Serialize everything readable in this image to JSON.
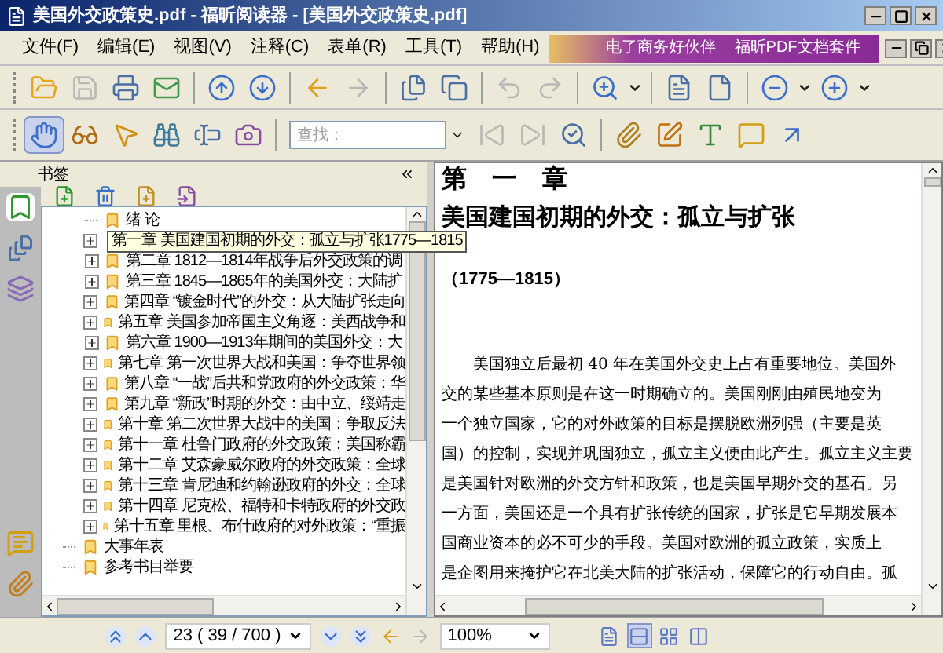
{
  "window": {
    "title": "美国外交政策史.pdf - 福昕阅读器 - [美国外交政策史.pdf]"
  },
  "menu": [
    "文件(F)",
    "编辑(E)",
    "视图(V)",
    "注释(C)",
    "表单(R)",
    "工具(T)",
    "帮助(H)"
  ],
  "banner": {
    "slogan": "电了商务好伙伴",
    "product": "福昕PDF文档套件"
  },
  "toolbar_1": [
    {
      "kind": "open",
      "disabled": false
    },
    {
      "kind": "save",
      "disabled": true
    },
    {
      "kind": "print",
      "disabled": false
    },
    {
      "kind": "mail",
      "disabled": false
    },
    {
      "kind": "sep"
    },
    {
      "kind": "up",
      "disabled": false
    },
    {
      "kind": "down",
      "disabled": false
    },
    {
      "kind": "sep"
    },
    {
      "kind": "back",
      "disabled": false
    },
    {
      "kind": "forward",
      "disabled": true
    },
    {
      "kind": "sep"
    },
    {
      "kind": "pages",
      "disabled": false
    },
    {
      "kind": "copy",
      "disabled": false
    },
    {
      "kind": "sep"
    },
    {
      "kind": "undo",
      "disabled": true
    },
    {
      "kind": "redo",
      "disabled": true
    },
    {
      "kind": "sep"
    },
    {
      "kind": "zoom",
      "disabled": false
    },
    {
      "kind": "caret",
      "disabled": false
    },
    {
      "kind": "sep"
    },
    {
      "kind": "fitpage",
      "disabled": false
    },
    {
      "kind": "fitwidth",
      "disabled": false
    },
    {
      "kind": "sep"
    },
    {
      "kind": "minus",
      "disabled": false
    },
    {
      "kind": "caret",
      "disabled": false
    },
    {
      "kind": "plus",
      "disabled": false
    },
    {
      "kind": "caret",
      "disabled": false
    }
  ],
  "toolbar_2": [
    {
      "kind": "hand",
      "selected": true,
      "disabled": false
    },
    {
      "kind": "glasses",
      "selected": false,
      "disabled": false
    },
    {
      "kind": "pointer",
      "selected": false,
      "disabled": false
    },
    {
      "kind": "binoculars",
      "selected": false,
      "disabled": false
    },
    {
      "kind": "textselect",
      "selected": false,
      "disabled": false
    },
    {
      "kind": "camera",
      "selected": false,
      "disabled": false
    },
    {
      "kind": "sep"
    },
    {
      "kind": "search",
      "placeholder": "查找："
    },
    {
      "kind": "prev",
      "selected": false,
      "disabled": true
    },
    {
      "kind": "next",
      "selected": false,
      "disabled": true
    },
    {
      "kind": "searchopt",
      "selected": false,
      "disabled": false
    },
    {
      "kind": "sep"
    },
    {
      "kind": "attach",
      "selected": false,
      "disabled": false
    },
    {
      "kind": "note",
      "selected": false,
      "disabled": false
    },
    {
      "kind": "textbox",
      "selected": false,
      "disabled": false
    },
    {
      "kind": "comment",
      "selected": false,
      "disabled": false
    },
    {
      "kind": "arrow",
      "selected": false,
      "disabled": false
    }
  ],
  "bookmarks": {
    "title": "书签",
    "tree": [
      {
        "children": [
          {
            "label": "绪 论",
            "expandable": false,
            "selected": false
          },
          {
            "label": "第一章 美国建国初期的外交：孤立与扩张1775—1815",
            "expandable": true,
            "expanded": false,
            "selected": true
          },
          {
            "label": "第二章 1812—1814年战争后外交政策的调",
            "expandable": true,
            "expanded": false,
            "selected": false
          },
          {
            "label": "第三章 1845—1865年的美国外交：大陆扩",
            "expandable": true,
            "expanded": false,
            "selected": false
          },
          {
            "label": "第四章 “镀金时代”的外交：从大陆扩张走向",
            "expandable": true,
            "expanded": false,
            "selected": false
          },
          {
            "label": "第五章 美国参加帝国主义角逐：美西战争和",
            "expandable": true,
            "expanded": false,
            "selected": false
          },
          {
            "label": "第六章 1900—1913年期间的美国外交：大",
            "expandable": true,
            "expanded": false,
            "selected": false
          },
          {
            "label": "第七章 第一次世界大战和美国：争夺世界领",
            "expandable": true,
            "expanded": false,
            "selected": false
          },
          {
            "label": "第八章 “一战”后共和党政府的外交政策：华",
            "expandable": true,
            "expanded": false,
            "selected": false
          },
          {
            "label": "第九章 “新政”时期的外交：由中立、绥靖走",
            "expandable": true,
            "expanded": false,
            "selected": false
          },
          {
            "label": "第十章 第二次世界大战中的美国：争取反法",
            "expandable": true,
            "expanded": false,
            "selected": false
          },
          {
            "label": "第十一章 杜鲁门政府的外交政策：美国称霸",
            "expandable": true,
            "expanded": false,
            "selected": false
          },
          {
            "label": "第十二章 艾森豪威尔政府的外交政策：全球",
            "expandable": true,
            "expanded": false,
            "selected": false
          },
          {
            "label": "第十三章 肯尼迪和约翰逊政府的外交：全球",
            "expandable": true,
            "expanded": false,
            "selected": false
          },
          {
            "label": "第十四章 尼克松、福特和卡特政府的外交政",
            "expandable": true,
            "expanded": false,
            "selected": false
          },
          {
            "label": "第十五章 里根、布什政府的对外政策：“重振",
            "expandable": true,
            "expanded": false,
            "selected": false
          }
        ]
      },
      {
        "label": "大事年表",
        "expandable": false,
        "selected": false
      },
      {
        "label": "参考书目举要",
        "expandable": false,
        "selected": false
      }
    ]
  },
  "document": {
    "chapter": "第　一　章",
    "heading": "美国建国初期的外交：孤立与扩张",
    "period": "（1775—1815）",
    "lines": [
      "　　美国独立后最初 40 年在美国外交史上占有重要地位。美国外",
      "交的某些基本原则是在这一时期确立的。美国刚刚由殖民地变为",
      "一个独立国家，它的对外政策的目标是摆脱欧洲列强（主要是英",
      "国）的控制，实现并巩固独立，孤立主义便由此产生。孤立主义主要",
      "是美国针对欧洲的外交方针和政策，也是美国早期外交的基石。另",
      "一方面，美国还是一个具有扩张传统的国家，扩张是它早期发展本",
      "国商业资本的必不可少的手段。美国对欧洲的孤立政策，实质上",
      "是企图用来掩护它在北美大陆的扩张活动，保障它的行动自由。孤"
    ]
  },
  "status_bar": {
    "page": "23 ( 39 / 700 )",
    "zoom": "100%",
    "view_modes": [
      {
        "selected": false
      },
      {
        "selected": true
      },
      {
        "selected": false
      },
      {
        "selected": false
      }
    ]
  }
}
